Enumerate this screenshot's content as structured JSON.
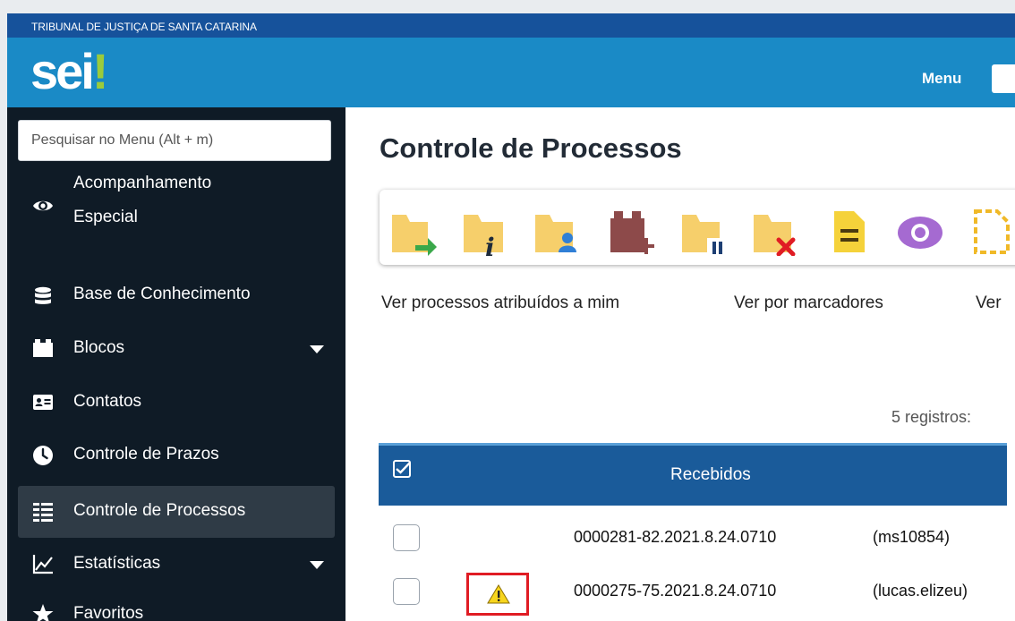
{
  "header": {
    "org_name": "TRIBUNAL DE JUSTIÇA DE SANTA CATARINA",
    "logo_text": "sei",
    "logo_mark": "!",
    "menu_label": "Menu"
  },
  "sidebar": {
    "search_placeholder": "Pesquisar no Menu (Alt + m)",
    "items": [
      {
        "label_line1": "Acompanhamento",
        "label_line2": "Especial",
        "icon": "eye-icon"
      },
      {
        "label": "Base de Conhecimento",
        "icon": "database-icon"
      },
      {
        "label": "Blocos",
        "icon": "blocks-icon",
        "has_submenu": true
      },
      {
        "label": "Contatos",
        "icon": "contact-card-icon"
      },
      {
        "label": "Controle de Prazos",
        "icon": "clock-icon"
      },
      {
        "label": "Controle de Processos",
        "icon": "list-icon",
        "active": true
      },
      {
        "label": "Estatísticas",
        "icon": "chart-line-icon",
        "has_submenu": true
      },
      {
        "label": "Favoritos",
        "icon": "star-icon"
      }
    ]
  },
  "main": {
    "title": "Controle de Processos",
    "toolbar_icons": [
      "send-folder-icon",
      "info-folder-icon",
      "assign-folder-icon",
      "add-block-icon",
      "pause-folder-icon",
      "close-folder-icon",
      "note-icon",
      "view-icon",
      "new-document-icon"
    ],
    "view_links": [
      "Ver processos atribuídos a mim",
      "Ver por marcadores",
      "Ver"
    ],
    "record_count": "5 registros:",
    "table": {
      "header": "Recebidos",
      "rows": [
        {
          "process": "0000281-82.2021.8.24.0710",
          "user": "(ms10854)",
          "warning": false
        },
        {
          "process": "0000275-75.2021.8.24.0710",
          "user": "(lucas.elizeu)",
          "warning": true
        }
      ]
    }
  },
  "colors": {
    "top_strip": "#16529b",
    "header": "#1a8ac6",
    "sidebar": "#0f1b26",
    "active_item": "#2f3b46",
    "table_header": "#1a5b9a",
    "folder": "#f6cf6b",
    "warning_border": "#e01c24"
  }
}
